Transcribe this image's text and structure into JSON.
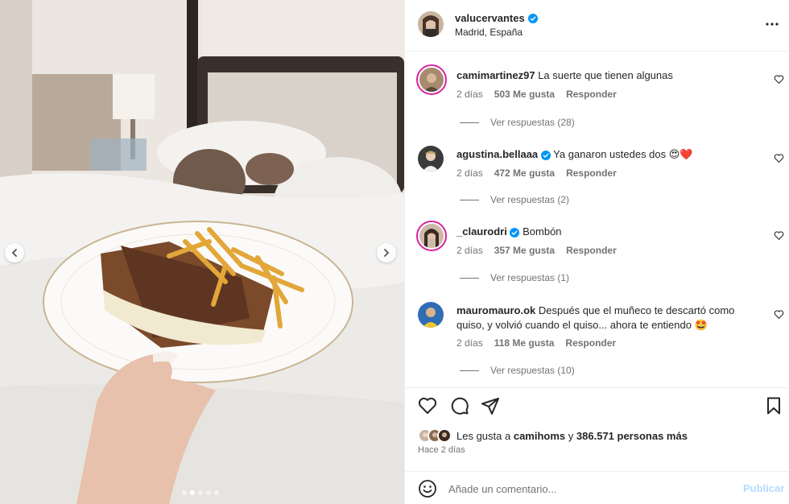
{
  "post": {
    "username": "valucervantes",
    "location": "Madrid, España",
    "verified": true
  },
  "photo": {
    "description_icon": "carousel-photo",
    "slide_count": 5,
    "active_slide": 2
  },
  "comments": [
    {
      "username": "camimartinez97",
      "text": "La suerte que tienen algunas",
      "time": "2 días",
      "likes": "503 Me gusta",
      "reply": "Responder",
      "replies": "Ver respuestas (28)",
      "verified": false,
      "story_ring": true,
      "avatar_color": "#8a6b4f"
    },
    {
      "username": "agustina.bellaaa",
      "text": "Ya ganaron ustedes dos 😍❤️",
      "time": "2 días",
      "likes": "472 Me gusta",
      "reply": "Responder",
      "replies": "Ver respuestas (2)",
      "verified": true,
      "story_ring": false,
      "avatar_color": "#3b3b3b"
    },
    {
      "username": "_claurodri",
      "text": "Bombón",
      "time": "2 días",
      "likes": "357 Me gusta",
      "reply": "Responder",
      "replies": "Ver respuestas (1)",
      "verified": true,
      "story_ring": true,
      "avatar_color": "#5a4034"
    },
    {
      "username": "mauromauro.ok",
      "text": "Después que el muñeco te descartó como quiso, y volvió cuando el quiso... ahora te entiendo 🤩",
      "time": "2 días",
      "likes": "118 Me gusta",
      "reply": "Responder",
      "replies": "Ver respuestas (10)",
      "verified": false,
      "story_ring": false,
      "avatar_color": "#2f6db5"
    }
  ],
  "likes": {
    "prefix": "Les gusta a",
    "user": "camihoms",
    "connector": "y",
    "others": "386.571 personas más"
  },
  "posted_ago": "Hace 2 días",
  "add_comment": {
    "placeholder": "Añade un comentario...",
    "post_label": "Publicar"
  },
  "colors": {
    "verified": "#0095f6",
    "post_disabled": "#b3dbff",
    "secondary_text": "#737373",
    "story_ring": "#d6249f"
  }
}
